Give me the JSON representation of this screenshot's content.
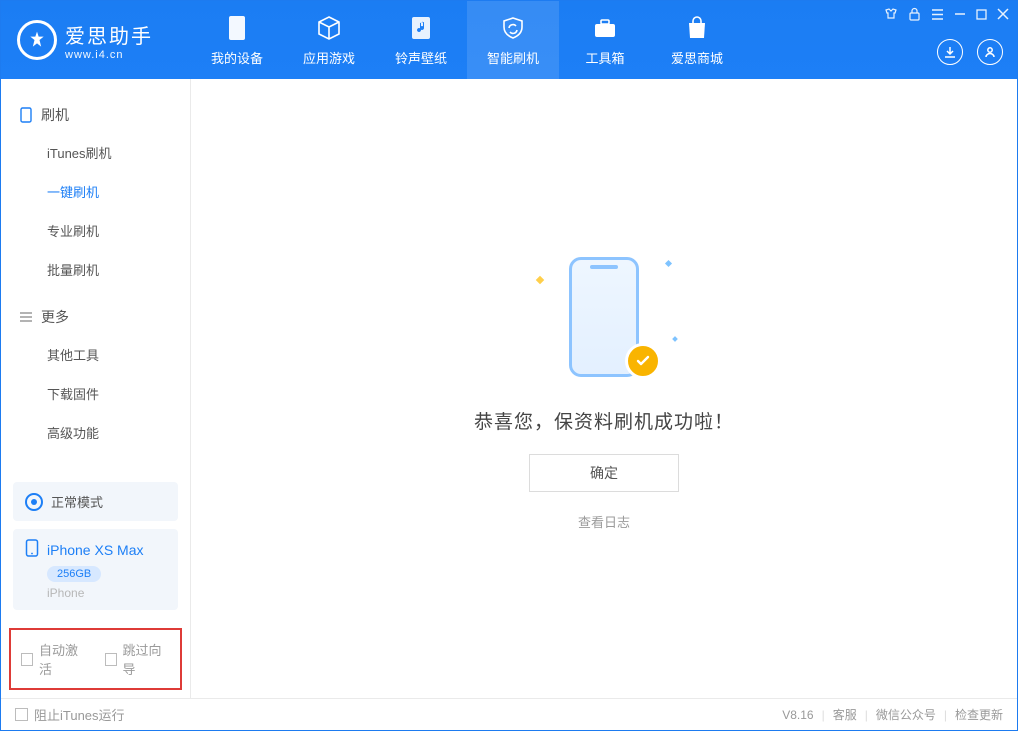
{
  "app": {
    "name": "爱思助手",
    "url": "www.i4.cn"
  },
  "tabs": [
    {
      "label": "我的设备"
    },
    {
      "label": "应用游戏"
    },
    {
      "label": "铃声壁纸"
    },
    {
      "label": "智能刷机"
    },
    {
      "label": "工具箱"
    },
    {
      "label": "爱思商城"
    }
  ],
  "sidebar": {
    "group1_title": "刷机",
    "group1_items": [
      {
        "label": "iTunes刷机"
      },
      {
        "label": "一键刷机"
      },
      {
        "label": "专业刷机"
      },
      {
        "label": "批量刷机"
      }
    ],
    "group2_title": "更多",
    "group2_items": [
      {
        "label": "其他工具"
      },
      {
        "label": "下载固件"
      },
      {
        "label": "高级功能"
      }
    ]
  },
  "mode": {
    "label": "正常模式"
  },
  "device": {
    "name": "iPhone XS Max",
    "storage": "256GB",
    "type": "iPhone"
  },
  "options": {
    "auto_activate": "自动激活",
    "skip_guide": "跳过向导"
  },
  "main": {
    "success_text": "恭喜您，保资料刷机成功啦！",
    "confirm": "确定",
    "view_log": "查看日志"
  },
  "footer": {
    "block_itunes": "阻止iTunes运行",
    "version": "V8.16",
    "support": "客服",
    "wechat": "微信公众号",
    "update": "检查更新"
  }
}
